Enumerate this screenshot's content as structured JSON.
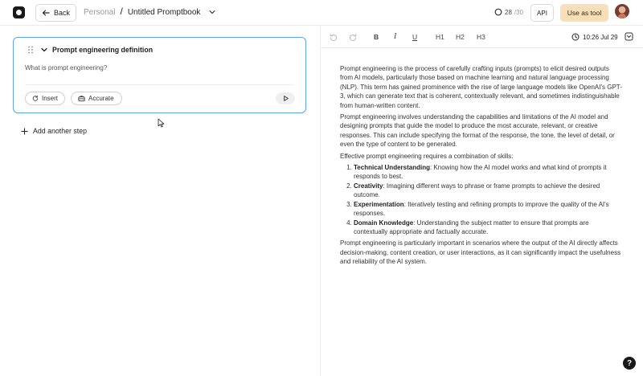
{
  "header": {
    "back_label": "Back",
    "workspace": "Personal",
    "separator": "/",
    "doc_title": "Untitled Promptbook",
    "credits_used": "28",
    "credits_total": "/30",
    "api_label": "API",
    "use_as_tool_label": "Use as tool"
  },
  "step": {
    "title": "Prompt engineering definition",
    "prompt": "What is prompt engineering?",
    "insert_label": "Insert",
    "accurate_label": "Accurate"
  },
  "add_step_label": "Add another step",
  "toolbar": {
    "bold": "B",
    "italic": "I",
    "underline": "U",
    "h1": "H1",
    "h2": "H2",
    "h3": "H3",
    "timestamp": "10:26 Jul 29"
  },
  "document": {
    "p1": "Prompt engineering is the process of carefully crafting inputs (prompts) to elicit desired outputs from AI models, particularly those based on machine learning and natural language processing (NLP). This term has gained prominence with the rise of large language models like OpenAI's GPT-3, which can generate text that is coherent, contextually relevant, and sometimes indistinguishable from human-written content.",
    "p2": "Prompt engineering involves understanding the capabilities and limitations of the AI model and designing prompts that guide the model to produce the most accurate, relevant, or creative responses. This can include specifying the format of the response, the tone, the level of detail, or even the type of content to be generated.",
    "p3": "Effective prompt engineering requires a combination of skills:",
    "skills": [
      {
        "term": "Technical Understanding",
        "desc": ": Knowing how the AI model works and what kind of prompts it responds to best."
      },
      {
        "term": "Creativity",
        "desc": ": Imagining different ways to phrase or frame prompts to achieve the desired outcome."
      },
      {
        "term": "Experimentation",
        "desc": ": Iteratively testing and refining prompts to improve the quality of the AI's responses."
      },
      {
        "term": "Domain Knowledge",
        "desc": ": Understanding the subject matter to ensure that prompts are contextually appropriate and factually accurate."
      }
    ],
    "p4": "Prompt engineering is particularly important in scenarios where the output of the AI directly affects decision-making, content creation, or user interactions, as it can significantly impact the usefulness and reliability of the AI system."
  },
  "help_label": "?",
  "icons": [
    "logo-icon",
    "arrow-left-icon",
    "chevron-down-icon",
    "credits-ring-icon",
    "avatar",
    "drag-handle-icon",
    "refresh-icon",
    "briefcase-icon",
    "play-icon",
    "plus-icon",
    "undo-icon",
    "redo-icon",
    "clock-icon",
    "expand-icon",
    "help-icon"
  ],
  "colors": {
    "accent_border": "#5aa8e8",
    "use_as_tool_bg": "#f7dfb9"
  }
}
